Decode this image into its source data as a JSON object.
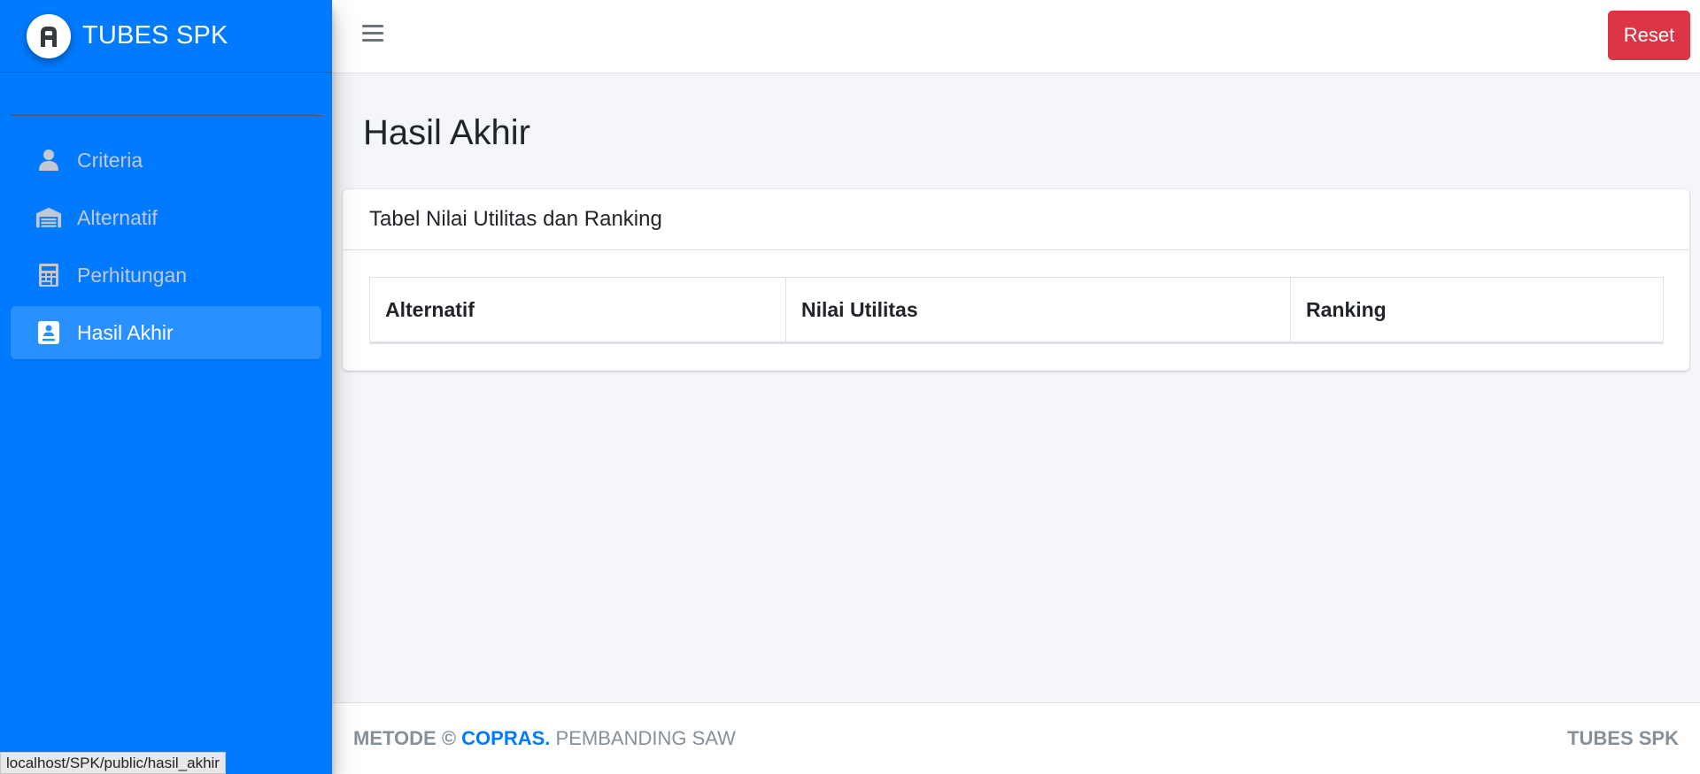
{
  "brand": {
    "title": "TUBES SPK",
    "logo_icon": "app-logo"
  },
  "sidebar": {
    "items": [
      {
        "label": "Criteria",
        "icon": "user-icon",
        "active": false
      },
      {
        "label": "Alternatif",
        "icon": "warehouse-icon",
        "active": false
      },
      {
        "label": "Perhitungan",
        "icon": "calculator-icon",
        "active": false
      },
      {
        "label": "Hasil Akhir",
        "icon": "user-badge-icon",
        "active": true
      }
    ]
  },
  "topbar": {
    "reset_label": "Reset"
  },
  "page": {
    "title": "Hasil Akhir",
    "card_title": "Tabel Nilai Utilitas dan Ranking",
    "table": {
      "columns": [
        "Alternatif",
        "Nilai Utilitas",
        "Ranking"
      ],
      "rows": []
    }
  },
  "footer": {
    "metode": "METODE ©",
    "method_link": "COPRAS.",
    "compare": "PEMBANDING SAW",
    "right": "TUBES SPK"
  },
  "statusbar": {
    "url": "localhost/SPK/public/hasil_akhir"
  },
  "colors": {
    "sidebar": "#007bff",
    "reset": "#dc3545",
    "active_item": "#2990ff",
    "background": "#f4f6f9"
  }
}
